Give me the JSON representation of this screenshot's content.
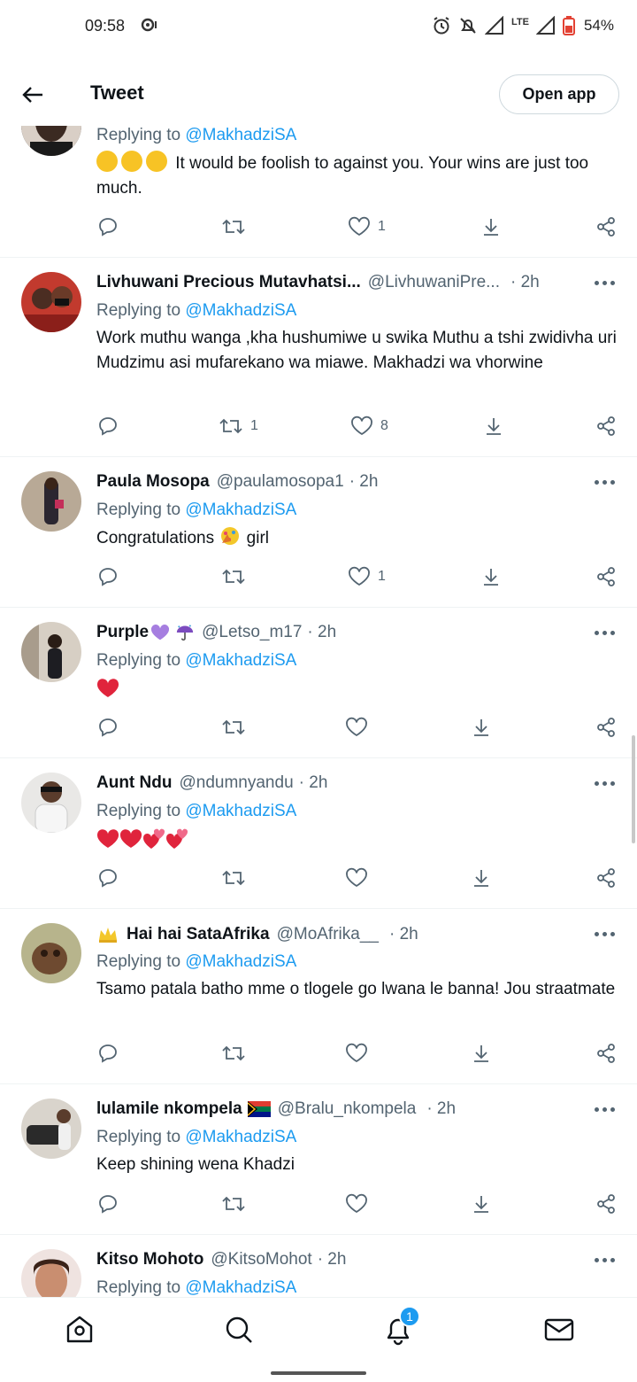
{
  "status_bar": {
    "time": "09:58",
    "network": "LTE",
    "battery": "54%"
  },
  "header": {
    "title": "Tweet",
    "open_app": "Open app"
  },
  "tweets": [
    {
      "name": "",
      "handle": "",
      "time": "",
      "replying_label": "Replying to",
      "replying_to": "@MakhadziSA",
      "text": "It would be foolish to against you. Your wins are just too much.",
      "emoji_prefix": "rolling-on-floor-laughing x3",
      "retweets": "",
      "likes": "1"
    },
    {
      "name": "Livhuwani Precious Mutavhatsi...",
      "handle": "@LivhuwaniPre...",
      "time": "· 2h",
      "replying_label": "Replying to",
      "replying_to": "@MakhadziSA",
      "text": "Work muthu wanga ,kha hushumiwe u swika Muthu a tshi zwidivha uri Mudzimu asi mufarekano wa miawe. Makhadzi wa vhorwine",
      "retweets": "1",
      "likes": "8"
    },
    {
      "name": "Paula Mosopa",
      "handle": "@paulamosopa1",
      "time": "· 2h",
      "replying_label": "Replying to",
      "replying_to": "@MakhadziSA",
      "text_before": "Congratulations",
      "text_after": "girl",
      "retweets": "",
      "likes": "1"
    },
    {
      "name": "Purple",
      "handle": "@Letso_m17",
      "time": "· 2h",
      "replying_label": "Replying to",
      "replying_to": "@MakhadziSA",
      "text": "",
      "retweets": "",
      "likes": ""
    },
    {
      "name": "Aunt Ndu",
      "handle": "@ndumnyandu",
      "time": "· 2h",
      "replying_label": "Replying to",
      "replying_to": "@MakhadziSA",
      "text": "",
      "retweets": "",
      "likes": ""
    },
    {
      "name": "Hai hai SataAfrika",
      "handle": "@MoAfrika__",
      "time": "· 2h",
      "replying_label": "Replying to",
      "replying_to": "@MakhadziSA",
      "text": "Tsamo patala batho mme o tlogele go lwana le banna! Jou straatmate",
      "retweets": "",
      "likes": ""
    },
    {
      "name": "lulamile nkompela",
      "handle": "@Bralu_nkompela",
      "time": "· 2h",
      "replying_label": "Replying to",
      "replying_to": "@MakhadziSA",
      "text": "Keep shining wena Khadzi",
      "retweets": "",
      "likes": ""
    },
    {
      "name": "Kitso Mohoto",
      "handle": "@KitsoMohot",
      "time": "· 2h",
      "replying_label": "Replying to",
      "replying_to": "@MakhadziSA",
      "text": ""
    }
  ],
  "bottom_nav": {
    "items": [
      "home-icon",
      "search-icon",
      "notifications-icon",
      "messages-icon"
    ],
    "notification_count": "1"
  },
  "colors": {
    "accent": "#1d9bf0",
    "text": "#0f1419",
    "secondary": "#536471"
  }
}
